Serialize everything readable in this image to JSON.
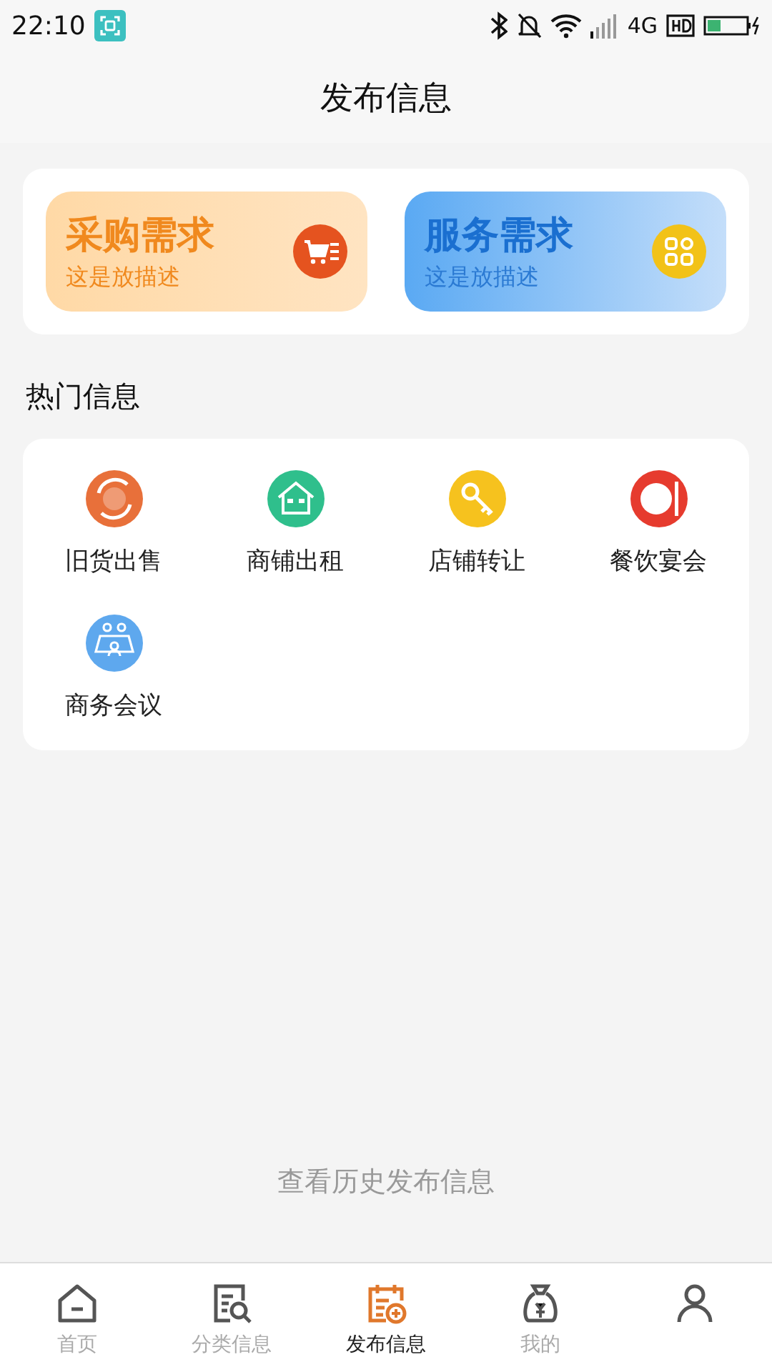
{
  "status_bar": {
    "time": "22:10",
    "network": "4G"
  },
  "header": {
    "title": "发布信息"
  },
  "quick_cards": [
    {
      "kind": "purchase",
      "title": "采购需求",
      "subtitle": "这是放描述"
    },
    {
      "kind": "service",
      "title": "服务需求",
      "subtitle": "这是放描述"
    }
  ],
  "hot_section": {
    "title": "热门信息",
    "items": [
      {
        "kind": "sale",
        "label": "旧货出售"
      },
      {
        "kind": "rent",
        "label": "商铺出租"
      },
      {
        "kind": "transfer",
        "label": "店铺转让"
      },
      {
        "kind": "dining",
        "label": "餐饮宴会"
      },
      {
        "kind": "meeting",
        "label": "商务会议"
      }
    ]
  },
  "history_link": "查看历史发布信息",
  "tab_bar": [
    {
      "kind": "home",
      "label": "首页",
      "selected": false
    },
    {
      "kind": "category",
      "label": "分类信息",
      "selected": false
    },
    {
      "kind": "publish",
      "label": "发布信息",
      "selected": true
    },
    {
      "kind": "mine",
      "label": "我的",
      "selected": false
    },
    {
      "kind": "person",
      "selected": false
    }
  ]
}
